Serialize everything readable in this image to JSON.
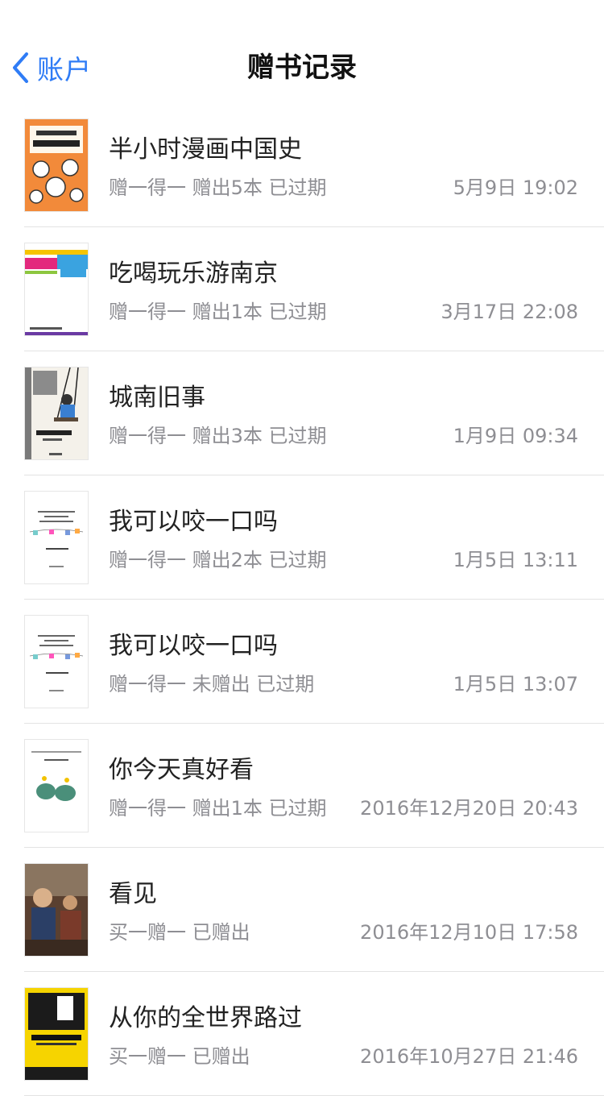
{
  "nav": {
    "back_label": "账户",
    "title": "赠书记录"
  },
  "records": [
    {
      "title": "半小时漫画中国史",
      "meta": "赠一得一 赠出5本 已过期",
      "date": "5月9日 19:02",
      "cover": "orange-comic-cover"
    },
    {
      "title": "吃喝玩乐游南京",
      "meta": "赠一得一 赠出1本 已过期",
      "date": "3月17日 22:08",
      "cover": "colorful-travel-cover"
    },
    {
      "title": "城南旧事",
      "meta": "赠一得一 赠出3本 已过期",
      "date": "1月9日 09:34",
      "cover": "illustrated-classic-cover"
    },
    {
      "title": "我可以咬一口吗",
      "meta": "赠一得一 赠出2本 已过期",
      "date": "1月5日 13:11",
      "cover": "white-minimal-cover"
    },
    {
      "title": "我可以咬一口吗",
      "meta": "赠一得一 未赠出 已过期",
      "date": "1月5日 13:07",
      "cover": "white-minimal-cover"
    },
    {
      "title": "你今天真好看",
      "meta": "赠一得一 赠出1本 已过期",
      "date": "2016年12月20日 20:43",
      "cover": "white-dino-cover"
    },
    {
      "title": "看见",
      "meta": "买一赠一 已赠出",
      "date": "2016年12月10日 17:58",
      "cover": "photo-cover"
    },
    {
      "title": "从你的全世界路过",
      "meta": "买一赠一 已赠出",
      "date": "2016年10月27日 21:46",
      "cover": "yellow-black-cover"
    }
  ]
}
